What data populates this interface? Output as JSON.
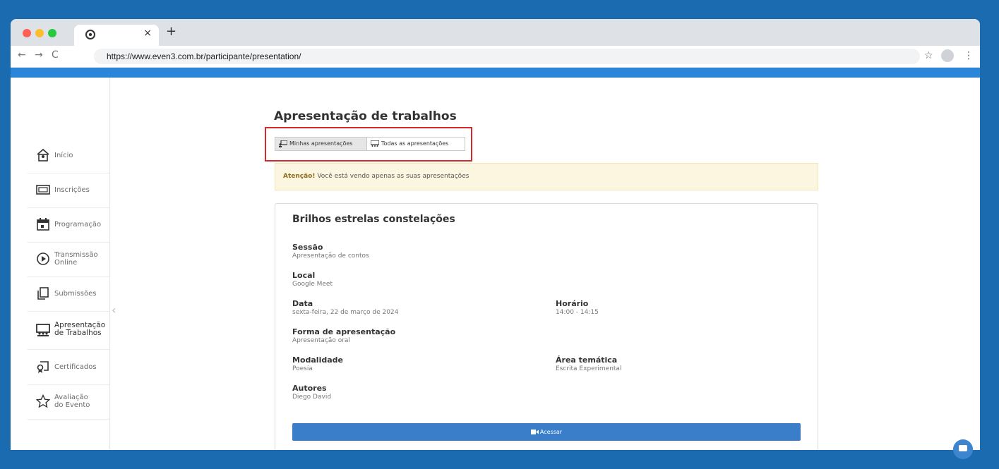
{
  "browser": {
    "tab": {
      "favicon": "chrome-icon",
      "close": "×"
    },
    "new_tab": "+",
    "nav": {
      "back": "←",
      "forward": "→",
      "reload": "C"
    },
    "url": "https://www.even3.com.br/participante/presentation/",
    "bookmark": "☆",
    "menu": "⋮"
  },
  "sidebar": {
    "items": [
      {
        "label": "Início",
        "icon": "home-icon"
      },
      {
        "label": "Inscrições",
        "icon": "ticket-icon"
      },
      {
        "label": "Programação",
        "icon": "calendar-icon"
      },
      {
        "label": "Transmissão\nOnline",
        "icon": "play-circle-icon"
      },
      {
        "label": "Submissões",
        "icon": "copy-document-icon"
      },
      {
        "label": "Apresentação\nde Trabalhos",
        "icon": "presentation-icon",
        "active": true
      },
      {
        "label": "Certificados",
        "icon": "certificate-icon"
      },
      {
        "label": "Avaliação\ndo Evento",
        "icon": "star-icon"
      }
    ]
  },
  "page": {
    "title": "Apresentação de trabalhos",
    "tabs": {
      "mine": "Minhas apresentações",
      "all": "Todas as apresentações"
    },
    "alert": {
      "strong": "Atenção!",
      "text": " Você está vendo apenas as suas apresentações"
    }
  },
  "card": {
    "title": "Brilhos estrelas constelações",
    "sessao": {
      "label": "Sessão",
      "value": "Apresentação de contos"
    },
    "local": {
      "label": "Local",
      "value": "Google Meet"
    },
    "data": {
      "label": "Data",
      "value": "sexta-feira, 22 de março de 2024"
    },
    "horario": {
      "label": "Horário",
      "value": "14:00 - 14:15"
    },
    "forma": {
      "label": "Forma de apresentação",
      "value": "Apresentação oral"
    },
    "modalidade": {
      "label": "Modalidade",
      "value": "Poesia"
    },
    "area": {
      "label": "Área temática",
      "value": "Escrita Experimental"
    },
    "autores": {
      "label": "Autores",
      "value": "Diego David"
    },
    "button": "Acessar"
  },
  "colors": {
    "accent": "#3a7dc9",
    "highlight": "#d62828",
    "alert_bg": "#fcf6e0"
  }
}
